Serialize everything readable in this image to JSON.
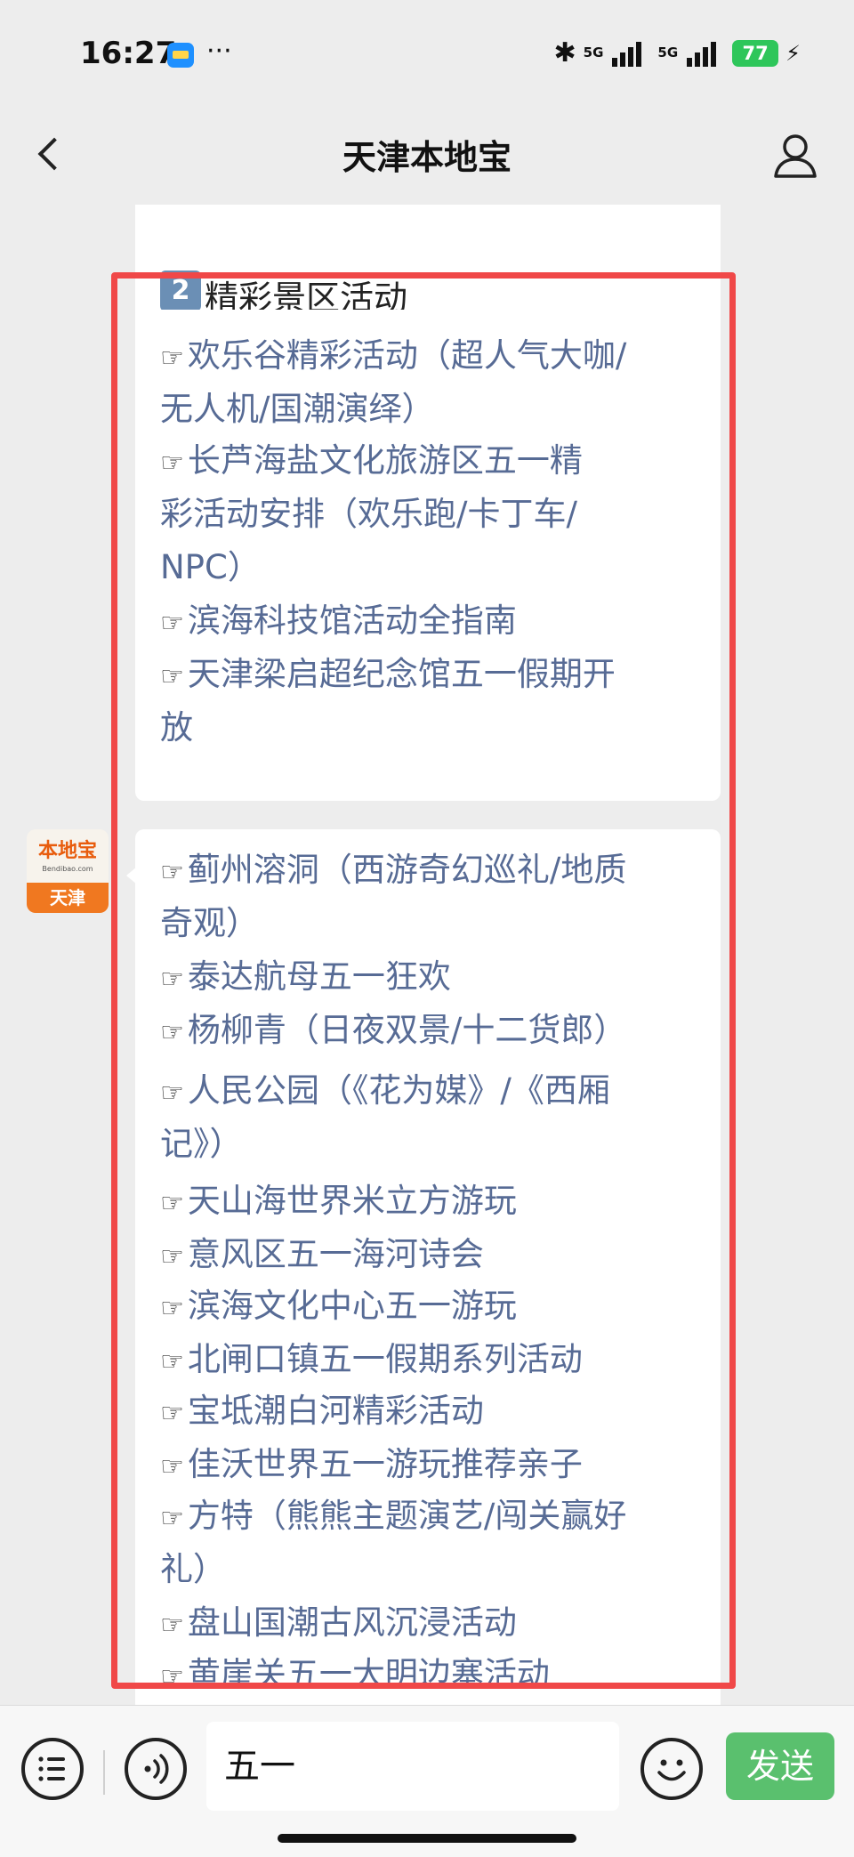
{
  "status_bar": {
    "time": "16:27",
    "app_icon": "wallet-icon",
    "more": "···",
    "network1": "5G",
    "network2": "5G",
    "battery": "77"
  },
  "nav": {
    "title": "天津本地宝",
    "back_icon": "chevron-left-icon",
    "profile_icon": "user-icon"
  },
  "chat": {
    "avatar": {
      "line1": "本地宝",
      "line2": "Bendibao.com",
      "city": "天津"
    },
    "section_heading": {
      "number": "2",
      "text": "精彩景区活动"
    },
    "hand_glyph": "☞",
    "bubble1_lines": [
      "欢乐谷精彩活动（超人气大咖/",
      "无人机/国潮演绎）",
      "长芦海盐文化旅游区五一精",
      "彩活动安排（欢乐跑/卡丁车/",
      "NPC）",
      "滨海科技馆活动全指南",
      "天津梁启超纪念馆五一假期开",
      "放"
    ],
    "bubble2_lines": [
      "蓟州溶洞（西游奇幻巡礼/地质",
      "奇观）",
      "泰达航母五一狂欢",
      "杨柳青（日夜双景/十二货郎）",
      "人民公园（《花为媒》/《西厢",
      "记》）",
      "天山海世界米立方游玩",
      "意风区五一海河诗会",
      "滨海文化中心五一游玩",
      "北闸口镇五一假期系列活动",
      "宝坻潮白河精彩活动",
      "佳沃世界五一游玩推荐亲子",
      "方特（熊熊主题演艺/闯关赢好",
      "礼）",
      "盘山国潮古风沉浸活动",
      "黄崖关五一大明边塞活动"
    ]
  },
  "input_bar": {
    "text": "五一",
    "send_label": "发送",
    "menu_icon": "list-menu-icon",
    "voice_icon": "voice-icon",
    "emoji_icon": "emoji-icon"
  },
  "colors": {
    "link": "#576b95",
    "highlight": "#f04848",
    "send": "#5ac06e",
    "background": "#ededed"
  }
}
